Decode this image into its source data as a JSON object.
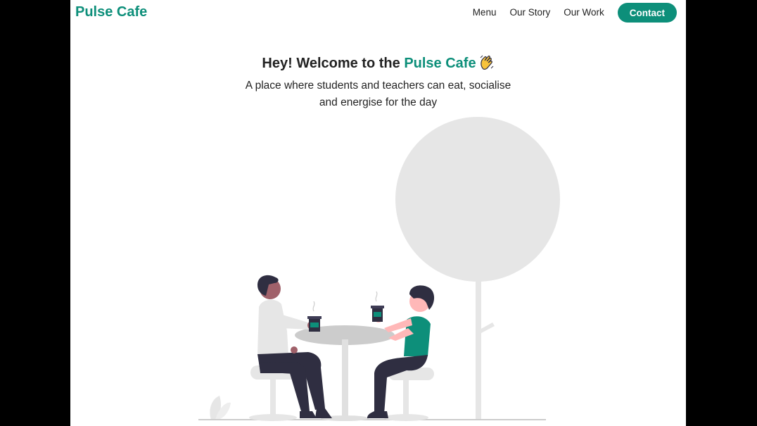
{
  "header": {
    "brand": "Pulse Cafe",
    "nav": [
      "Menu",
      "Our Story",
      "Our Work"
    ],
    "cta_label": "Contact"
  },
  "hero": {
    "title_prefix": "Hey! Welcome to the ",
    "title_brand": "Pulse Cafe",
    "subtitle": "A place where students and teachers can eat, socialise and energise for the day"
  },
  "colors": {
    "accent": "#0d8f7a",
    "text": "#222222",
    "background": "#ffffff",
    "illustration_grey": "#e6e6e6"
  },
  "icons": {
    "wave": "waving-hand-icon"
  }
}
